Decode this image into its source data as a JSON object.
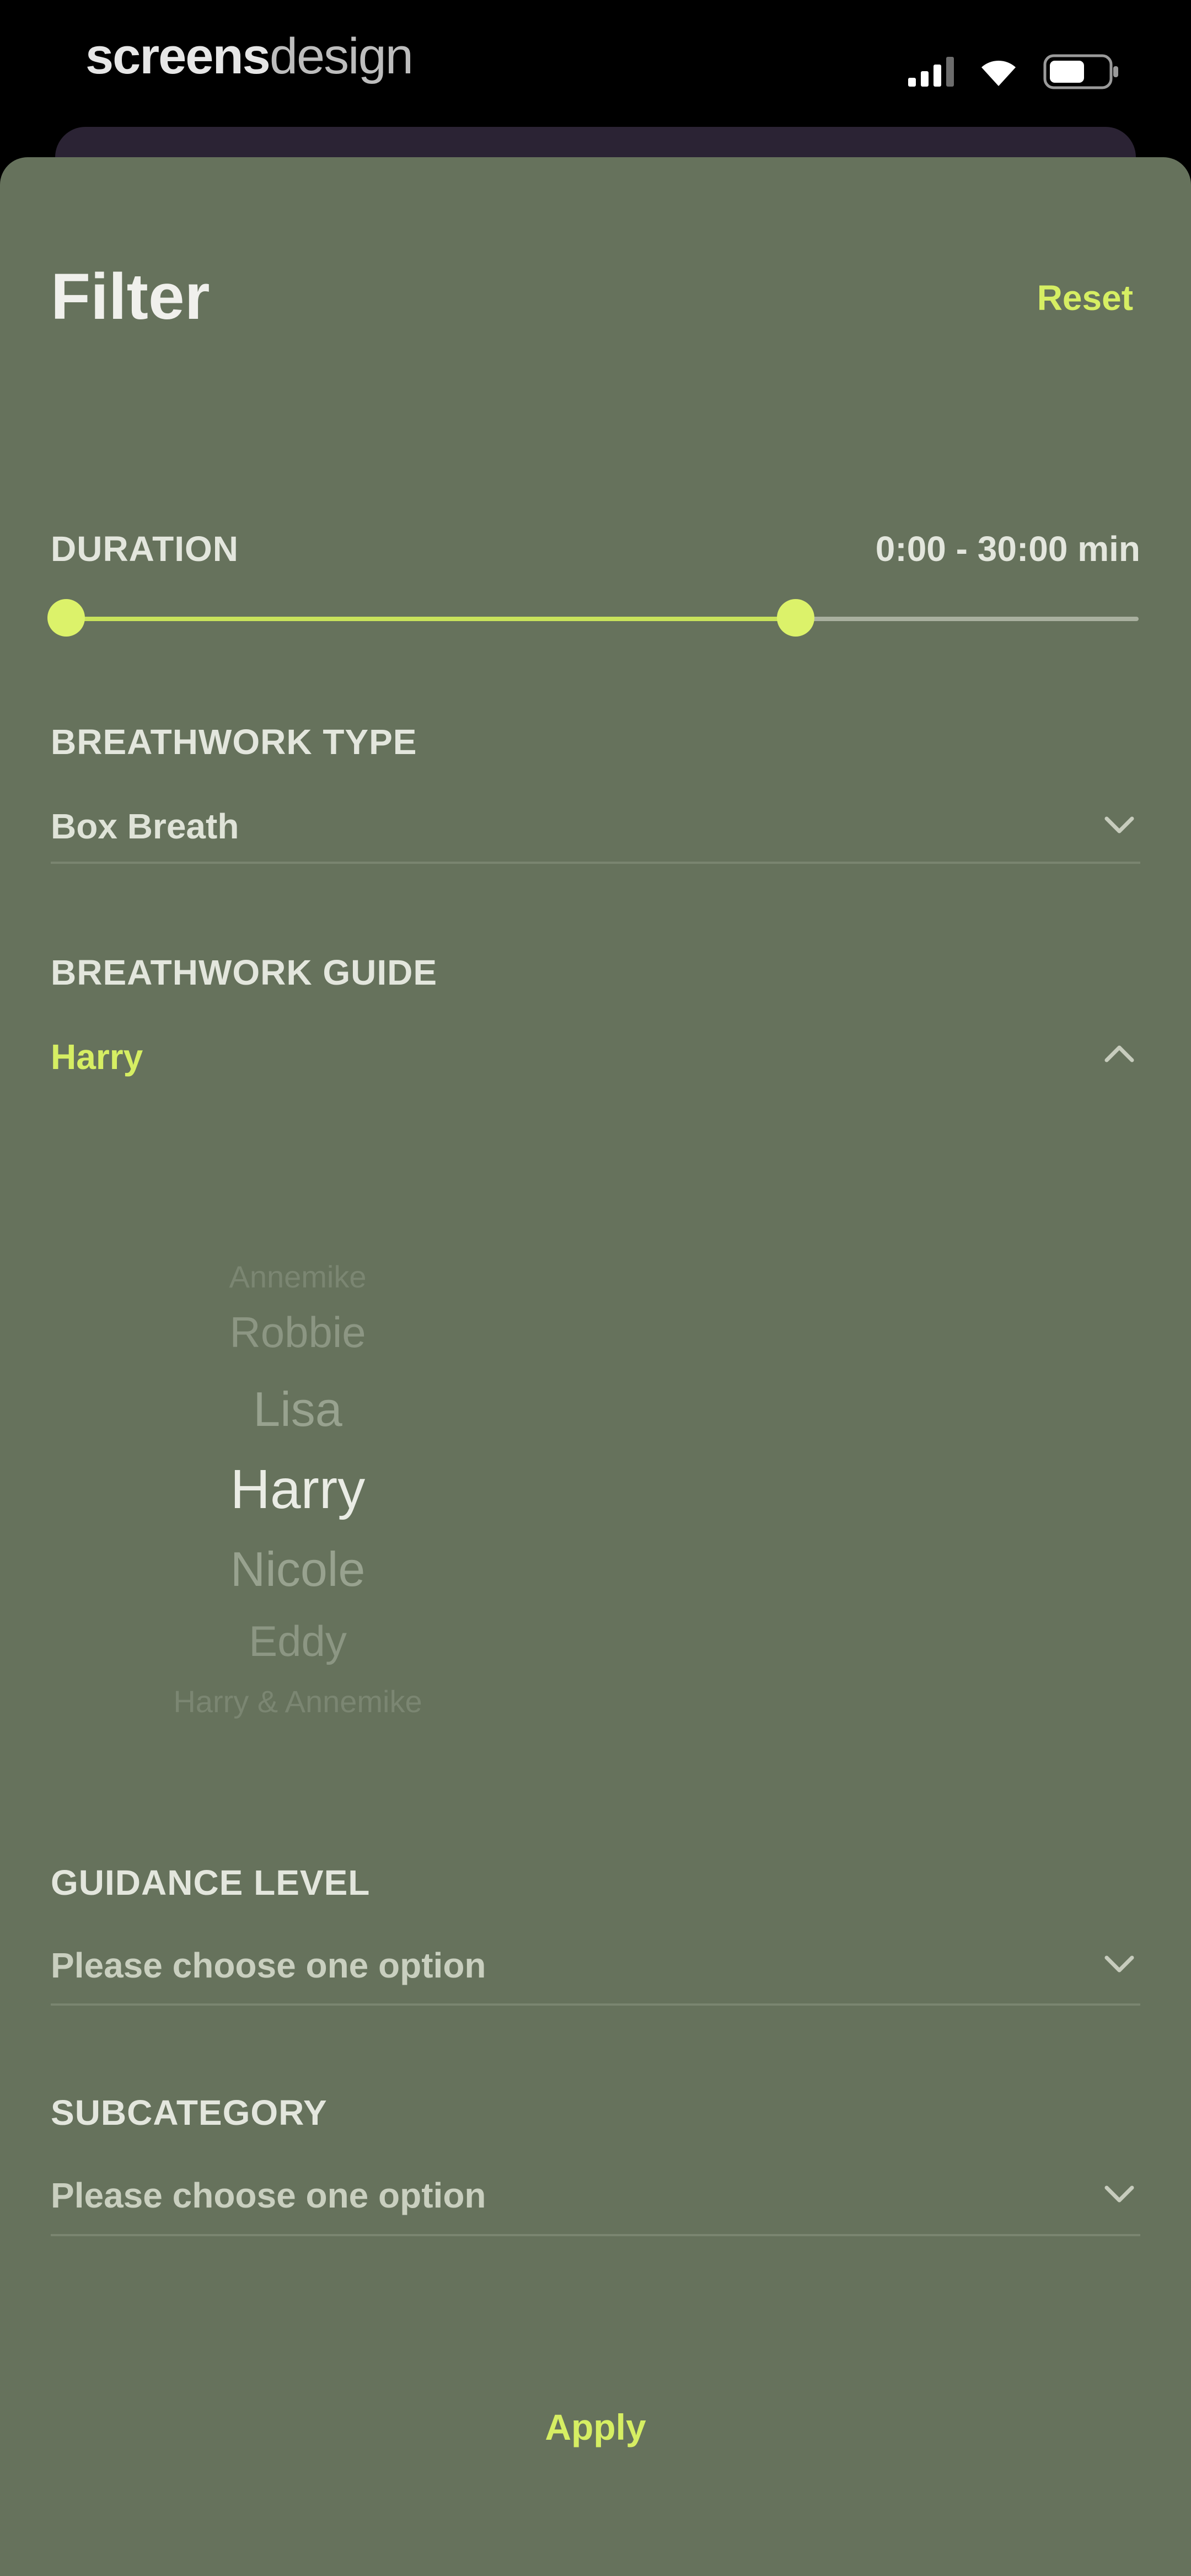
{
  "status_bar": {
    "brand_primary": "screens",
    "brand_secondary": "design",
    "icons": [
      "cellular-signal-icon",
      "wifi-icon",
      "battery-icon"
    ]
  },
  "filter": {
    "title": "Filter",
    "reset_label": "Reset",
    "duration": {
      "label": "DURATION",
      "range_text": "0:00 - 30:00 min",
      "selected_start_fraction": 0.0,
      "selected_end_fraction": 0.68
    },
    "breathwork_type": {
      "label": "BREATHWORK TYPE",
      "value": "Box Breath"
    },
    "breathwork_guide": {
      "label": "BREATHWORK GUIDE",
      "value": "Harry",
      "expanded": true,
      "picker_options": [
        "Annemike",
        "Robbie",
        "Lisa",
        "Harry",
        "Nicole",
        "Eddy",
        "Harry & Annemike"
      ],
      "picker_selected": "Harry"
    },
    "guidance_level": {
      "label": "GUIDANCE LEVEL",
      "placeholder": "Please choose one option"
    },
    "subcategory": {
      "label": "SUBCATEGORY",
      "placeholder": "Please choose one option"
    },
    "apply_label": "Apply"
  },
  "colors": {
    "sheet_background": "#66725c",
    "accent": "#d6ee63",
    "text_primary": "#f0f0ec"
  }
}
